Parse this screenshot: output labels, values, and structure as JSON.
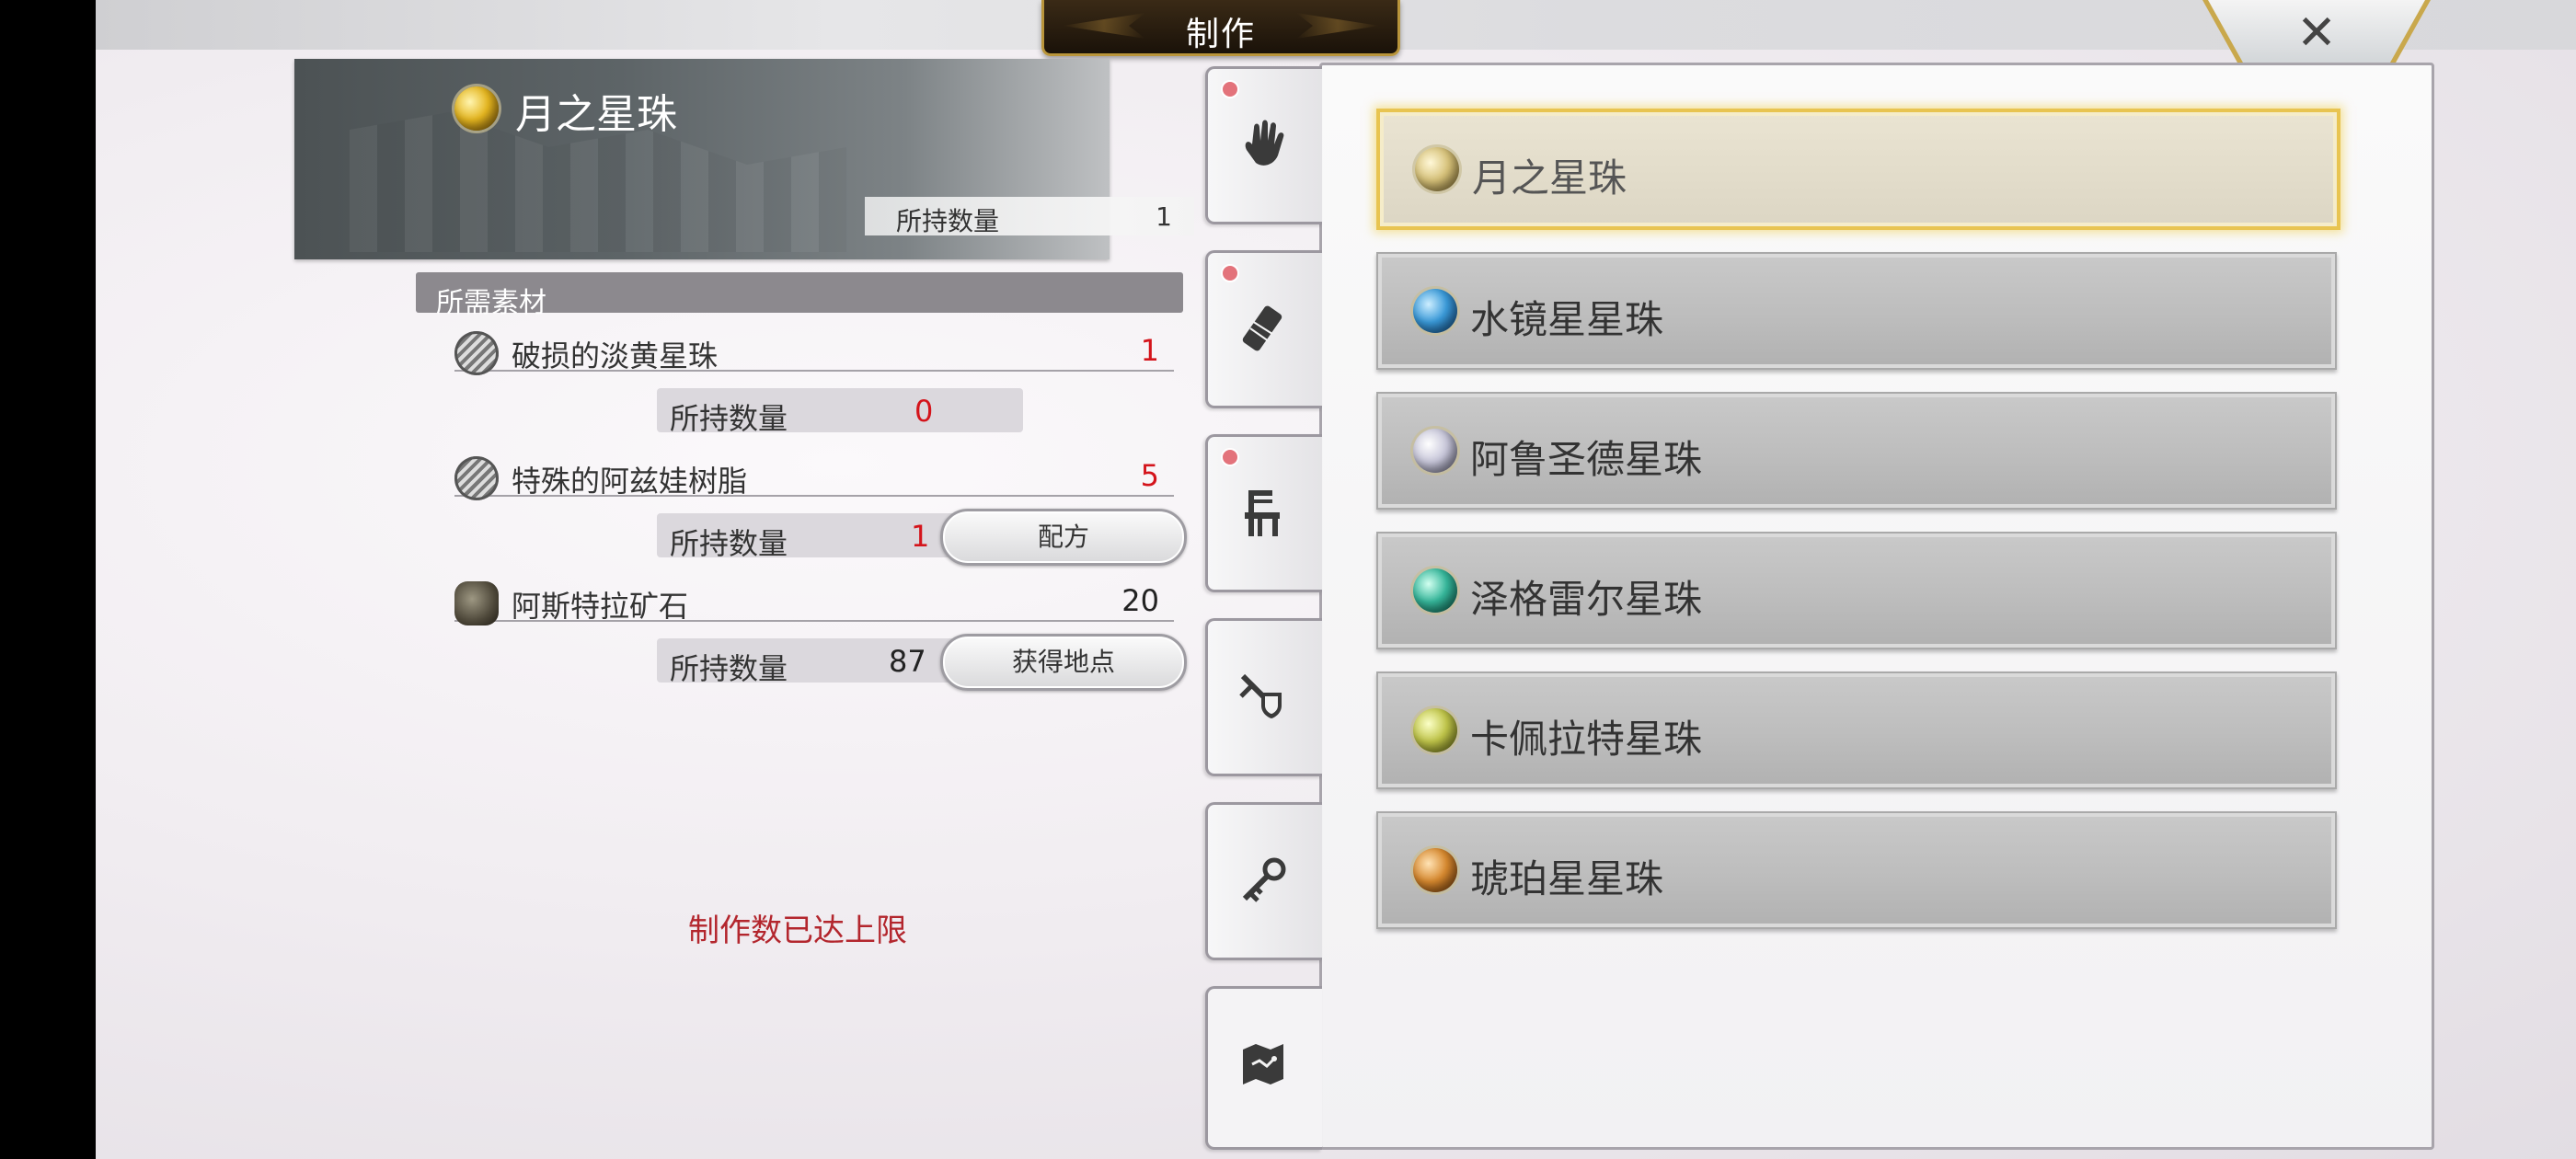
{
  "header": {
    "title": "制作",
    "close_symbol": "✕"
  },
  "selected_item": {
    "name": "月之星珠",
    "owned_label": "所持数量",
    "owned_value": "1"
  },
  "materials": {
    "header": "所需素材",
    "items": [
      {
        "name": "破损的淡黄星珠",
        "required": "1",
        "owned_label": "所持数量",
        "owned": "0"
      },
      {
        "name": "特殊的阿兹娃树脂",
        "required": "5",
        "owned_label": "所持数量",
        "owned": "1",
        "button": "配方"
      },
      {
        "name": "阿斯特拉矿石",
        "required": "20",
        "owned_label": "所持数量",
        "owned": "87",
        "button": "获得地点"
      }
    ]
  },
  "status_message": "制作数已达上限",
  "tabs": [
    {
      "icon": "hand-icon",
      "badge": true
    },
    {
      "icon": "bandage-icon",
      "badge": true
    },
    {
      "icon": "chair-icon",
      "badge": true
    },
    {
      "icon": "sword-shield-icon",
      "badge": false
    },
    {
      "icon": "key-icon",
      "badge": false
    },
    {
      "icon": "map-icon",
      "badge": false
    }
  ],
  "recipes": [
    {
      "name": "月之星珠",
      "orb": "pale-gold",
      "selected": true
    },
    {
      "name": "水镜星星珠",
      "orb": "blue"
    },
    {
      "name": "阿鲁圣德星珠",
      "orb": "silver"
    },
    {
      "name": "泽格雷尔星珠",
      "orb": "teal"
    },
    {
      "name": "卡佩拉特星珠",
      "orb": "olive"
    },
    {
      "name": "琥珀星星珠",
      "orb": "amber"
    }
  ]
}
